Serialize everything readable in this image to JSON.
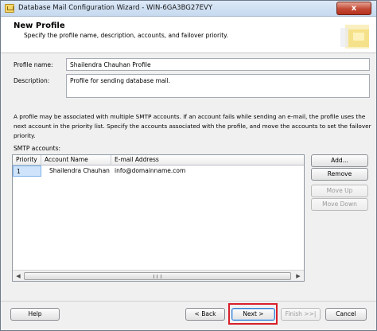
{
  "window": {
    "title": "Database Mail Configuration Wizard - WIN-6GA3BG27EVY",
    "close_label": "x"
  },
  "header": {
    "title": "New Profile",
    "subtitle": "Specify the profile name, description, accounts, and failover priority."
  },
  "form": {
    "profile_name_label": "Profile name:",
    "profile_name_value": "Shailendra Chauhan Profile",
    "description_label": "Description:",
    "description_value": "Profile for sending database mail."
  },
  "note": "A profile may be associated with multiple SMTP accounts. If an account fails while sending an e-mail, the profile uses the next account in the priority list. Specify the accounts associated with the profile, and move the accounts to set the failover priority.",
  "smtp": {
    "label": "SMTP accounts:",
    "columns": [
      "Priority",
      "Account Name",
      "E-mail Address"
    ],
    "rows": [
      {
        "priority": "1",
        "account_name": "Shailendra Chauhan",
        "email": "info@domainname.com"
      }
    ]
  },
  "side_buttons": {
    "add": "Add...",
    "remove": "Remove",
    "move_up": "Move Up",
    "move_down": "Move Down"
  },
  "footer": {
    "help": "Help",
    "back": "< Back",
    "next": "Next >",
    "finish": "Finish >>|",
    "cancel": "Cancel"
  },
  "colors": {
    "highlight": "#d8202a",
    "selection": "#cfe4fb"
  }
}
